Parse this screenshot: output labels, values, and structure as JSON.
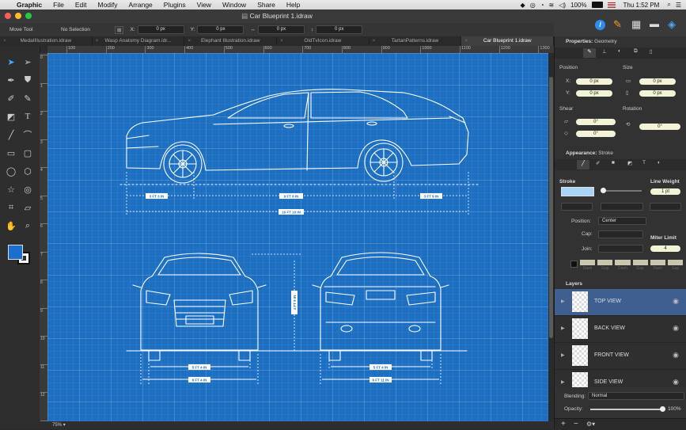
{
  "menubar": {
    "apple": "",
    "app_name": "Graphic",
    "items": [
      "File",
      "Edit",
      "Modify",
      "Arrange",
      "Plugins",
      "View",
      "Window",
      "Share",
      "Help"
    ],
    "battery": "100%",
    "clock": "Thu 1:52 PM"
  },
  "window": {
    "title": "Car Blueprint 1.idraw"
  },
  "toolbar": {
    "tool_name": "Move Tool",
    "selection": "No Selection",
    "x_label": "X:",
    "x_value": "0 px",
    "y_label": "Y:",
    "y_value": "0 px",
    "w_value": "0 px",
    "h_value": "0 px"
  },
  "tabs": [
    {
      "label": "MedalIllustration.idraw",
      "active": false
    },
    {
      "label": "Wasp Anatomy Diagram.idr...",
      "active": false
    },
    {
      "label": "Elephant Illustration.idraw",
      "active": false
    },
    {
      "label": "OldTvIcon.idraw",
      "active": false
    },
    {
      "label": "TartanPatterns.idraw",
      "active": false
    },
    {
      "label": "Car Blueprint 1.idraw",
      "active": true
    }
  ],
  "ruler": {
    "h_ticks": [
      "100",
      "200",
      "300",
      "400",
      "500",
      "600",
      "700",
      "800",
      "900",
      "1000",
      "1100",
      "1200",
      "1300"
    ],
    "v_ticks": [
      "0",
      "1",
      "2",
      "3",
      "4",
      "5",
      "6",
      "7",
      "8",
      "9",
      "10",
      "11",
      "12",
      "13"
    ]
  },
  "tools": [
    "select-arrow-icon",
    "direct-select-icon",
    "pen-icon",
    "fill-icon",
    "brush-icon",
    "pencil-icon",
    "eraser-icon",
    "text-icon",
    "line-icon",
    "arc-icon",
    "rectangle-icon",
    "rounded-rect-icon",
    "ellipse-icon",
    "polygon-icon",
    "star-icon",
    "spiral-icon",
    "crop-icon",
    "skew-icon",
    "hand-icon",
    "zoom-icon"
  ],
  "colors": {
    "canvas": "#1d6fc2",
    "fill_swatch": "#1a6fd0",
    "stroke_swatch": "#ffffff",
    "accent": "#4aa8ff",
    "stroke_color": "#a8d4f5"
  },
  "blueprint": {
    "side_dims": [
      "3 FT 3 IN",
      "9 FT 8 IN",
      "3 FT 9 IN",
      "16 FT 10 IN"
    ],
    "front_dims": [
      "5 FT 4 IN",
      "6 FT 4 IN"
    ],
    "rear_dims": [
      "5 FT 4 IN",
      "6 FT 11 IN"
    ],
    "height_dim": "4 FT 9 IN"
  },
  "status": {
    "zoom": "75%"
  },
  "panel": {
    "title": "Properties:",
    "subtitle": "Geometry",
    "position_label": "Position",
    "size_label": "Size",
    "pos_x_label": "X:",
    "pos_x": "0 px",
    "pos_y_label": "Y:",
    "pos_y": "0 px",
    "size_w": "0 px",
    "size_h": "0 px",
    "shear_label": "Shear",
    "rotation_label": "Rotation",
    "shear_1": "0°",
    "shear_2": "0°",
    "rotation": "0°",
    "appearance_label": "Appearance:",
    "appearance_value": "Stroke",
    "stroke_label": "Stroke",
    "line_weight_label": "Line Weight",
    "line_weight": "1 pt",
    "position2_label": "Position:",
    "position2_value": "Center",
    "cap_label": "Cap:",
    "join_label": "Join:",
    "miter_label": "Miter Limit",
    "miter_value": "4",
    "dash_labels": [
      "Dash",
      "Gap",
      "Dash",
      "Gap",
      "Dash",
      "Gap"
    ],
    "layers_label": "Layers",
    "layers": [
      "TOP VIEW",
      "BACK VIEW",
      "FRONT VIEW",
      "SIDE VIEW"
    ],
    "blending_label": "Blending:",
    "blending_value": "Normal",
    "opacity_label": "Opacity:",
    "opacity_value": "100%"
  }
}
